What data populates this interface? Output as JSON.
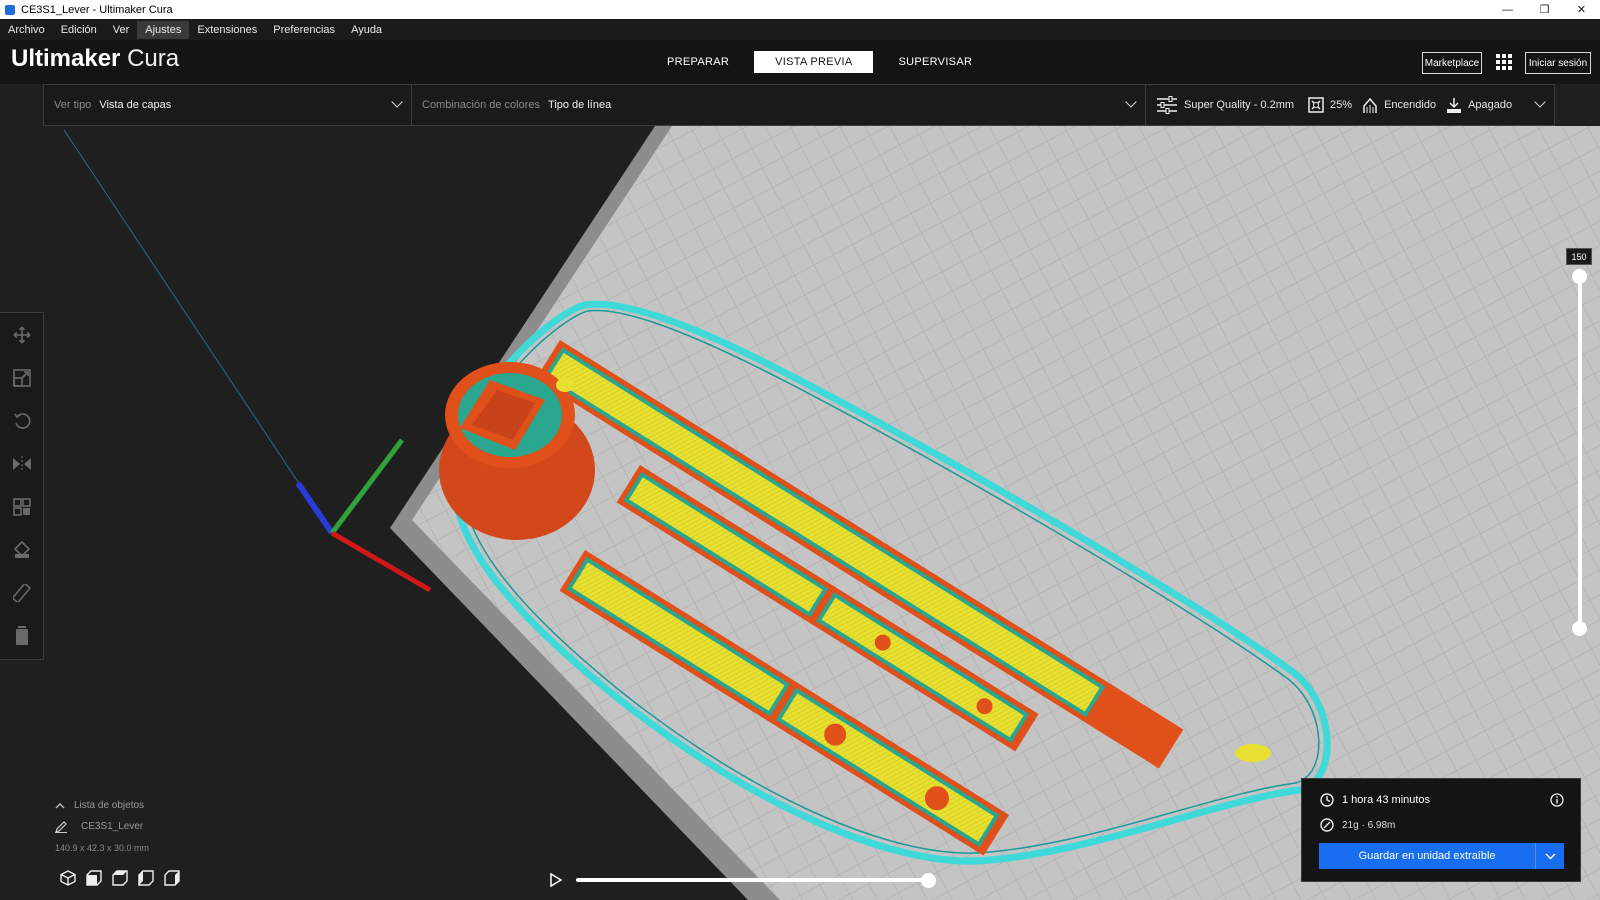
{
  "window": {
    "title": "CE3S1_Lever - Ultimaker Cura",
    "minimize": "—",
    "restore": "❐",
    "close": "✕"
  },
  "menubar": {
    "items": [
      "Archivo",
      "Edición",
      "Ver",
      "Ajustes",
      "Extensiones",
      "Preferencias",
      "Ayuda"
    ],
    "active": "Ajustes"
  },
  "header": {
    "logo_bold": "Ultimaker",
    "logo_light": "Cura",
    "stages": [
      {
        "label": "PREPARAR",
        "active": false
      },
      {
        "label": "VISTA PREVIA",
        "active": true
      },
      {
        "label": "SUPERVISAR",
        "active": false
      }
    ],
    "marketplace": "Marketplace",
    "login": "Iniciar sesión"
  },
  "viewbar": {
    "view_type_label": "Ver tipo",
    "view_type_value": "Vista de capas",
    "color_scheme_label": "Combinación de colores",
    "color_scheme_value": "Tipo de línea",
    "profile": "Super Quality - 0.2mm",
    "infill": "25%",
    "support": "Encendido",
    "adhesion": "Apagado"
  },
  "left_tools": [
    "move-icon",
    "scale-icon",
    "rotate-icon",
    "mirror-icon",
    "per-model-settings-icon",
    "support-blocker-icon",
    "measure-icon",
    "delete-icon"
  ],
  "layer_slider": {
    "current_layer": "150",
    "upper_fraction": 1.0,
    "lower_fraction": 0.0
  },
  "object_list": {
    "header": "Lista de objetos",
    "object_name": "CE3S1_Lever",
    "dimensions": "140.9 x 42.3 x 30.0 mm"
  },
  "view_buttons": [
    "view-3d-icon",
    "view-front-icon",
    "view-top-icon",
    "view-left-icon",
    "view-right-icon"
  ],
  "simulation": {
    "progress_fraction": 1.0
  },
  "print_info": {
    "time": "1 hora 43 minutos",
    "material": "21g · 6.98m",
    "save_label": "Guardar en unidad extraíble"
  },
  "colors": {
    "accent_blue": "#196ef0",
    "wall_orange": "#e0501a",
    "infill_yellow": "#e8e030",
    "skirt_cyan": "#3fd9d9",
    "inner_wall_green": "#2aa58e",
    "build_plate": "#bdbdbd"
  }
}
